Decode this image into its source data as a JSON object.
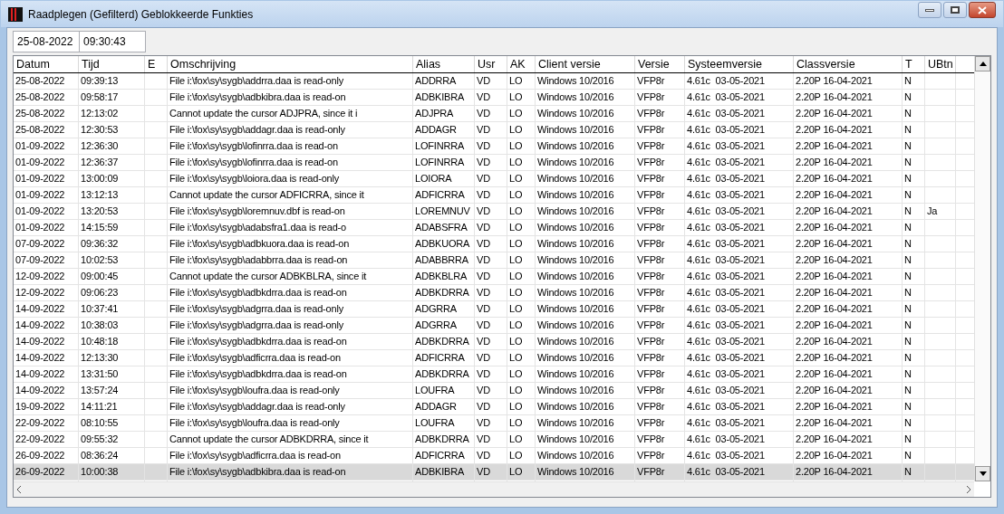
{
  "window": {
    "title": "Raadplegen (Gefilterd) Geblokkeerde Funkties"
  },
  "filter": {
    "datum": "25-08-2022",
    "tijd": "09:30:43"
  },
  "table": {
    "columns": [
      {
        "label": "Datum"
      },
      {
        "label": "Tijd"
      },
      {
        "label": "E"
      },
      {
        "label": "Omschrijving"
      },
      {
        "label": "Alias"
      },
      {
        "label": "Usr"
      },
      {
        "label": "AK"
      },
      {
        "label": "Client versie"
      },
      {
        "label": "Versie"
      },
      {
        "label": "Systeemversie"
      },
      {
        "label": "Classversie"
      },
      {
        "label": "T"
      },
      {
        "label": "UBtn"
      }
    ],
    "rows": [
      {
        "datum": "25-08-2022",
        "tijd": "09:39:13",
        "omschrijving": "File i:\\fox\\sy\\sygb\\addrra.daa is read-only",
        "alias": "ADDRRA",
        "usr": "VD",
        "ak": "LO",
        "client": "Windows 10/2016",
        "versie": "VFP8r",
        "systeem": "4.61c  03-05-2021",
        "class": "2.20P 16-04-2021",
        "t": "N",
        "selected": false
      },
      {
        "datum": "25-08-2022",
        "tijd": "09:58:17",
        "omschrijving": "File i:\\fox\\sy\\sygb\\adbkibra.daa is read-on",
        "alias": "ADBKIBRA",
        "usr": "VD",
        "ak": "LO",
        "client": "Windows 10/2016",
        "versie": "VFP8r",
        "systeem": "4.61c  03-05-2021",
        "class": "2.20P 16-04-2021",
        "t": "N",
        "selected": false
      },
      {
        "datum": "25-08-2022",
        "tijd": "12:13:02",
        "omschrijving": "Cannot update the cursor ADJPRA, since it i",
        "alias": "ADJPRA",
        "usr": "VD",
        "ak": "LO",
        "client": "Windows 10/2016",
        "versie": "VFP8r",
        "systeem": "4.61c  03-05-2021",
        "class": "2.20P 16-04-2021",
        "t": "N",
        "selected": false
      },
      {
        "datum": "25-08-2022",
        "tijd": "12:30:53",
        "omschrijving": "File i:\\fox\\sy\\sygb\\addagr.daa is read-only",
        "alias": "ADDAGR",
        "usr": "VD",
        "ak": "LO",
        "client": "Windows 10/2016",
        "versie": "VFP8r",
        "systeem": "4.61c  03-05-2021",
        "class": "2.20P 16-04-2021",
        "t": "N",
        "selected": false
      },
      {
        "datum": "01-09-2022",
        "tijd": "12:36:30",
        "omschrijving": "File i:\\fox\\sy\\sygb\\lofinrra.daa is read-on",
        "alias": "LOFINRRA",
        "usr": "VD",
        "ak": "LO",
        "client": "Windows 10/2016",
        "versie": "VFP8r",
        "systeem": "4.61c  03-05-2021",
        "class": "2.20P 16-04-2021",
        "t": "N",
        "selected": false
      },
      {
        "datum": "01-09-2022",
        "tijd": "12:36:37",
        "omschrijving": "File i:\\fox\\sy\\sygb\\lofinrra.daa is read-on",
        "alias": "LOFINRRA",
        "usr": "VD",
        "ak": "LO",
        "client": "Windows 10/2016",
        "versie": "VFP8r",
        "systeem": "4.61c  03-05-2021",
        "class": "2.20P 16-04-2021",
        "t": "N",
        "selected": false
      },
      {
        "datum": "01-09-2022",
        "tijd": "13:00:09",
        "omschrijving": "File i:\\fox\\sy\\sygb\\loiora.daa is read-only",
        "alias": "LOIORA",
        "usr": "VD",
        "ak": "LO",
        "client": "Windows 10/2016",
        "versie": "VFP8r",
        "systeem": "4.61c  03-05-2021",
        "class": "2.20P 16-04-2021",
        "t": "N",
        "selected": false
      },
      {
        "datum": "01-09-2022",
        "tijd": "13:12:13",
        "omschrijving": "Cannot update the cursor ADFICRRA, since it",
        "alias": "ADFICRRA",
        "usr": "VD",
        "ak": "LO",
        "client": "Windows 10/2016",
        "versie": "VFP8r",
        "systeem": "4.61c  03-05-2021",
        "class": "2.20P 16-04-2021",
        "t": "N",
        "selected": false
      },
      {
        "datum": "01-09-2022",
        "tijd": "13:20:53",
        "omschrijving": "File i:\\fox\\sy\\sygb\\loremnuv.dbf is read-on",
        "alias": "LOREMNUV",
        "usr": "VD",
        "ak": "LO",
        "client": "Windows 10/2016",
        "versie": "VFP8r",
        "systeem": "4.61c  03-05-2021",
        "class": "2.20P 16-04-2021",
        "t": "N",
        "ubtn": "Ja",
        "selected": false
      },
      {
        "datum": "01-09-2022",
        "tijd": "14:15:59",
        "omschrijving": "File i:\\fox\\sy\\sygb\\adabsfra1.daa is read-o",
        "alias": "ADABSFRA",
        "usr": "VD",
        "ak": "LO",
        "client": "Windows 10/2016",
        "versie": "VFP8r",
        "systeem": "4.61c  03-05-2021",
        "class": "2.20P 16-04-2021",
        "t": "N",
        "selected": false
      },
      {
        "datum": "07-09-2022",
        "tijd": "09:36:32",
        "omschrijving": "File i:\\fox\\sy\\sygb\\adbkuora.daa is read-on",
        "alias": "ADBKUORA",
        "usr": "VD",
        "ak": "LO",
        "client": "Windows 10/2016",
        "versie": "VFP8r",
        "systeem": "4.61c  03-05-2021",
        "class": "2.20P 16-04-2021",
        "t": "N",
        "selected": false
      },
      {
        "datum": "07-09-2022",
        "tijd": "10:02:53",
        "omschrijving": "File i:\\fox\\sy\\sygb\\adabbrra.daa is read-on",
        "alias": "ADABBRRA",
        "usr": "VD",
        "ak": "LO",
        "client": "Windows 10/2016",
        "versie": "VFP8r",
        "systeem": "4.61c  03-05-2021",
        "class": "2.20P 16-04-2021",
        "t": "N",
        "selected": false
      },
      {
        "datum": "12-09-2022",
        "tijd": "09:00:45",
        "omschrijving": "Cannot update the cursor ADBKBLRA, since it",
        "alias": "ADBKBLRA",
        "usr": "VD",
        "ak": "LO",
        "client": "Windows 10/2016",
        "versie": "VFP8r",
        "systeem": "4.61c  03-05-2021",
        "class": "2.20P 16-04-2021",
        "t": "N",
        "selected": false
      },
      {
        "datum": "12-09-2022",
        "tijd": "09:06:23",
        "omschrijving": "File i:\\fox\\sy\\sygb\\adbkdrra.daa is read-on",
        "alias": "ADBKDRRA",
        "usr": "VD",
        "ak": "LO",
        "client": "Windows 10/2016",
        "versie": "VFP8r",
        "systeem": "4.61c  03-05-2021",
        "class": "2.20P 16-04-2021",
        "t": "N",
        "selected": false
      },
      {
        "datum": "14-09-2022",
        "tijd": "10:37:41",
        "omschrijving": "File i:\\fox\\sy\\sygb\\adgrra.daa is read-only",
        "alias": "ADGRRA",
        "usr": "VD",
        "ak": "LO",
        "client": "Windows 10/2016",
        "versie": "VFP8r",
        "systeem": "4.61c  03-05-2021",
        "class": "2.20P 16-04-2021",
        "t": "N",
        "selected": false
      },
      {
        "datum": "14-09-2022",
        "tijd": "10:38:03",
        "omschrijving": "File i:\\fox\\sy\\sygb\\adgrra.daa is read-only",
        "alias": "ADGRRA",
        "usr": "VD",
        "ak": "LO",
        "client": "Windows 10/2016",
        "versie": "VFP8r",
        "systeem": "4.61c  03-05-2021",
        "class": "2.20P 16-04-2021",
        "t": "N",
        "selected": false
      },
      {
        "datum": "14-09-2022",
        "tijd": "10:48:18",
        "omschrijving": "File i:\\fox\\sy\\sygb\\adbkdrra.daa is read-on",
        "alias": "ADBKDRRA",
        "usr": "VD",
        "ak": "LO",
        "client": "Windows 10/2016",
        "versie": "VFP8r",
        "systeem": "4.61c  03-05-2021",
        "class": "2.20P 16-04-2021",
        "t": "N",
        "selected": false
      },
      {
        "datum": "14-09-2022",
        "tijd": "12:13:30",
        "omschrijving": "File i:\\fox\\sy\\sygb\\adficrra.daa is read-on",
        "alias": "ADFICRRA",
        "usr": "VD",
        "ak": "LO",
        "client": "Windows 10/2016",
        "versie": "VFP8r",
        "systeem": "4.61c  03-05-2021",
        "class": "2.20P 16-04-2021",
        "t": "N",
        "selected": false
      },
      {
        "datum": "14-09-2022",
        "tijd": "13:31:50",
        "omschrijving": "File i:\\fox\\sy\\sygb\\adbkdrra.daa is read-on",
        "alias": "ADBKDRRA",
        "usr": "VD",
        "ak": "LO",
        "client": "Windows 10/2016",
        "versie": "VFP8r",
        "systeem": "4.61c  03-05-2021",
        "class": "2.20P 16-04-2021",
        "t": "N",
        "selected": false
      },
      {
        "datum": "14-09-2022",
        "tijd": "13:57:24",
        "omschrijving": "File i:\\fox\\sy\\sygb\\loufra.daa is read-only",
        "alias": "LOUFRA",
        "usr": "VD",
        "ak": "LO",
        "client": "Windows 10/2016",
        "versie": "VFP8r",
        "systeem": "4.61c  03-05-2021",
        "class": "2.20P 16-04-2021",
        "t": "N",
        "selected": false
      },
      {
        "datum": "19-09-2022",
        "tijd": "14:11:21",
        "omschrijving": "File i:\\fox\\sy\\sygb\\addagr.daa is read-only",
        "alias": "ADDAGR",
        "usr": "VD",
        "ak": "LO",
        "client": "Windows 10/2016",
        "versie": "VFP8r",
        "systeem": "4.61c  03-05-2021",
        "class": "2.20P 16-04-2021",
        "t": "N",
        "selected": false
      },
      {
        "datum": "22-09-2022",
        "tijd": "08:10:55",
        "omschrijving": "File i:\\fox\\sy\\sygb\\loufra.daa is read-only",
        "alias": "LOUFRA",
        "usr": "VD",
        "ak": "LO",
        "client": "Windows 10/2016",
        "versie": "VFP8r",
        "systeem": "4.61c  03-05-2021",
        "class": "2.20P 16-04-2021",
        "t": "N",
        "selected": false
      },
      {
        "datum": "22-09-2022",
        "tijd": "09:55:32",
        "omschrijving": "Cannot update the cursor ADBKDRRA, since it",
        "alias": "ADBKDRRA",
        "usr": "VD",
        "ak": "LO",
        "client": "Windows 10/2016",
        "versie": "VFP8r",
        "systeem": "4.61c  03-05-2021",
        "class": "2.20P 16-04-2021",
        "t": "N",
        "selected": false
      },
      {
        "datum": "26-09-2022",
        "tijd": "08:36:24",
        "omschrijving": "File i:\\fox\\sy\\sygb\\adficrra.daa is read-on",
        "alias": "ADFICRRA",
        "usr": "VD",
        "ak": "LO",
        "client": "Windows 10/2016",
        "versie": "VFP8r",
        "systeem": "4.61c  03-05-2021",
        "class": "2.20P 16-04-2021",
        "t": "N",
        "selected": false
      },
      {
        "datum": "26-09-2022",
        "tijd": "10:00:38",
        "omschrijving": "File i:\\fox\\sy\\sygb\\adbkibra.daa is read-on",
        "alias": "ADBKIBRA",
        "usr": "VD",
        "ak": "LO",
        "client": "Windows 10/2016",
        "versie": "VFP8r",
        "systeem": "4.61c  03-05-2021",
        "class": "2.20P 16-04-2021",
        "t": "N",
        "selected": true
      }
    ]
  }
}
